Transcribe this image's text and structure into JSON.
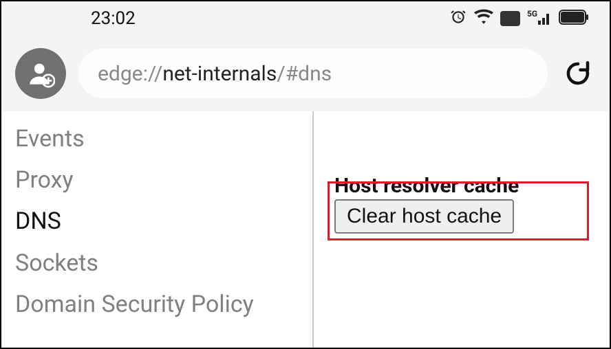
{
  "statusbar": {
    "time": "23:02"
  },
  "toolbar": {
    "url_prefix": "edge://",
    "url_strong": "net-internals",
    "url_suffix": "/#dns"
  },
  "sidebar": {
    "items": [
      {
        "label": "Events",
        "active": false
      },
      {
        "label": "Proxy",
        "active": false
      },
      {
        "label": "DNS",
        "active": true
      },
      {
        "label": "Sockets",
        "active": false
      },
      {
        "label": "Domain Security Policy",
        "active": false
      }
    ]
  },
  "main": {
    "section_title": "Host resolver cache",
    "clear_button": "Clear host cache"
  }
}
